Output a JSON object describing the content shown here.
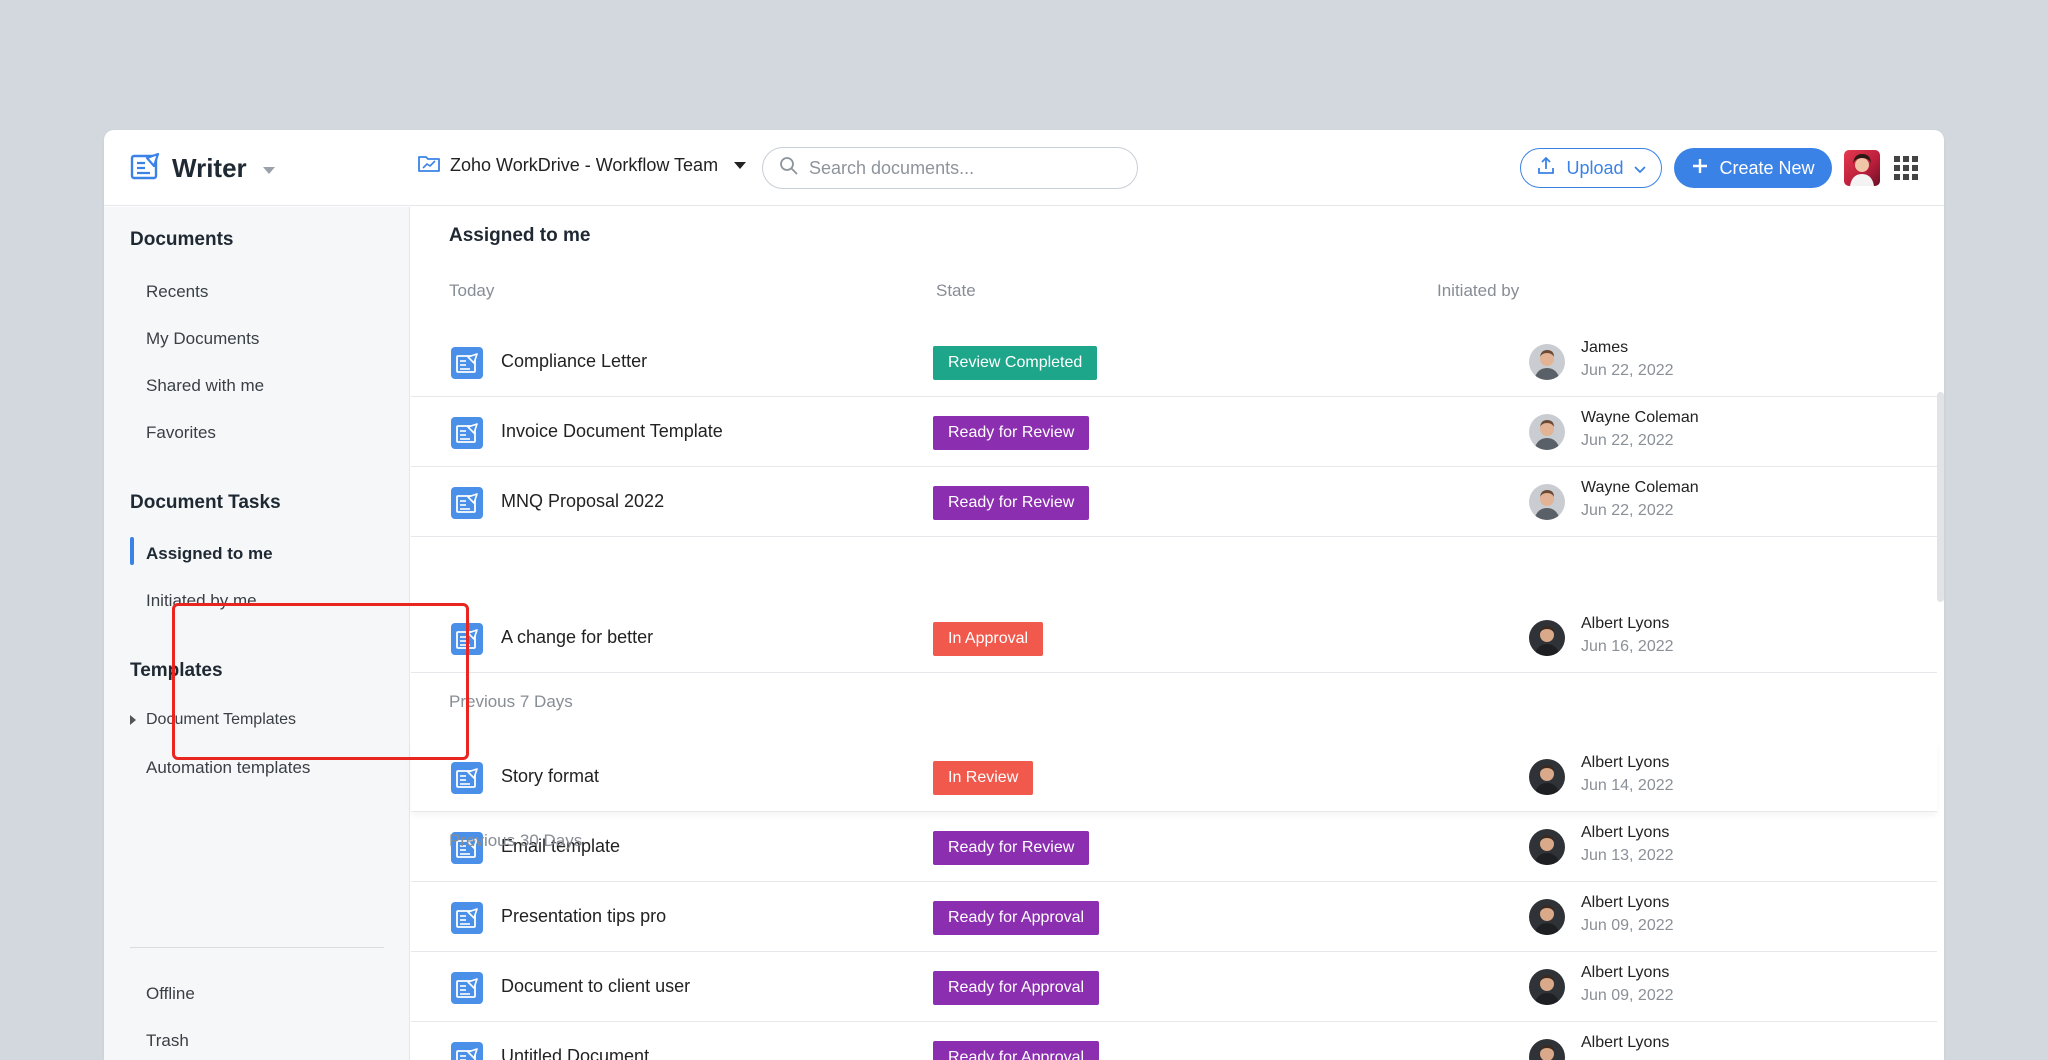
{
  "header": {
    "app_name": "Writer",
    "workspace": "Zoho WorkDrive - Workflow Team",
    "search_placeholder": "Search documents...",
    "upload_label": "Upload",
    "create_label": "Create New"
  },
  "sidebar": {
    "documents_heading": "Documents",
    "documents_items": [
      "Recents",
      "My Documents",
      "Shared with me",
      "Favorites"
    ],
    "tasks_heading": "Document Tasks",
    "tasks_items": [
      "Assigned to me",
      "Initiated by me"
    ],
    "templates_heading": "Templates",
    "templates_items": [
      "Document Templates",
      "Automation templates"
    ],
    "bottom_items": [
      "Offline",
      "Trash"
    ]
  },
  "main": {
    "title": "Assigned to me",
    "columns": {
      "state": "State",
      "initiated_by": "Initiated by"
    },
    "groups": [
      "Today",
      "Previous 7 Days",
      "Previous 30 Days"
    ],
    "rows": [
      {
        "name": "Compliance Letter",
        "state": "Review Completed",
        "state_color": "#1ea68a",
        "initiator": "James",
        "date": "Jun 22, 2022"
      },
      {
        "name": "Invoice Document Template",
        "state": "Ready for Review",
        "state_color": "#8b2fb0",
        "initiator": "Wayne Coleman",
        "date": "Jun 22, 2022"
      },
      {
        "name": "MNQ Proposal 2022",
        "state": "Ready for Review",
        "state_color": "#8b2fb0",
        "initiator": "Wayne Coleman",
        "date": "Jun 22, 2022"
      },
      {
        "name": "A change for better",
        "state": "In Approval",
        "state_color": "#f0594c",
        "initiator": "Albert Lyons",
        "date": "Jun 16, 2022"
      },
      {
        "name": "Story format",
        "state": "In Review",
        "state_color": "#f0594c",
        "initiator": "Albert Lyons",
        "date": "Jun 14, 2022"
      },
      {
        "name": "Email template",
        "state": "Ready for Review",
        "state_color": "#8b2fb0",
        "initiator": "Albert Lyons",
        "date": "Jun 13, 2022"
      },
      {
        "name": "Presentation tips pro",
        "state": "Ready for Approval",
        "state_color": "#8b2fb0",
        "initiator": "Albert Lyons",
        "date": "Jun 09, 2022"
      },
      {
        "name": "Document to client user",
        "state": "Ready for Approval",
        "state_color": "#8b2fb0",
        "initiator": "Albert Lyons",
        "date": "Jun 09, 2022"
      },
      {
        "name": "Untitled Document",
        "state": "Ready for Approval",
        "state_color": "#8b2fb0",
        "initiator": "Albert Lyons",
        "date": ""
      }
    ]
  },
  "colors": {
    "accent": "#3b82e6",
    "highlight": "#e8261f"
  }
}
